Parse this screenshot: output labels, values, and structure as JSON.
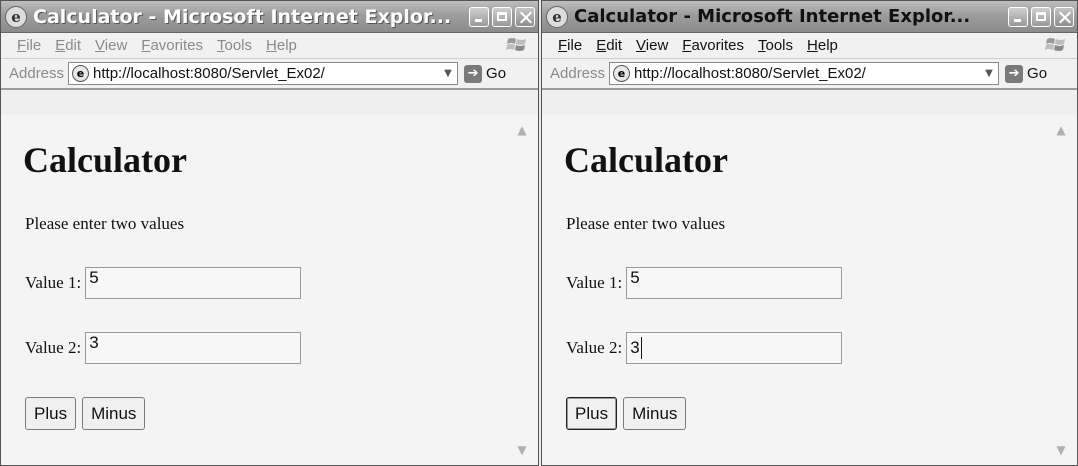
{
  "windows": [
    {
      "title": "Calculator - Microsoft Internet Explor...",
      "menu": [
        "File",
        "Edit",
        "View",
        "Favorites",
        "Tools",
        "Help"
      ],
      "address_label": "Address",
      "url": "http://localhost:8080/Servlet_Ex02/",
      "go_label": "Go",
      "page": {
        "heading": "Calculator",
        "instruction": "Please enter two values",
        "value1_label": "Value 1:",
        "value1": "5",
        "value2_label": "Value 2:",
        "value2": "3",
        "plus_label": "Plus",
        "minus_label": "Minus"
      }
    },
    {
      "title": "Calculator - Microsoft Internet Explor...",
      "menu": [
        "File",
        "Edit",
        "View",
        "Favorites",
        "Tools",
        "Help"
      ],
      "address_label": "Address",
      "url": "http://localhost:8080/Servlet_Ex02/",
      "go_label": "Go",
      "page": {
        "heading": "Calculator",
        "instruction": "Please enter two values",
        "value1_label": "Value 1:",
        "value1": "5",
        "value2_label": "Value 2:",
        "value2": "3",
        "plus_label": "Plus",
        "minus_label": "Minus"
      }
    }
  ]
}
